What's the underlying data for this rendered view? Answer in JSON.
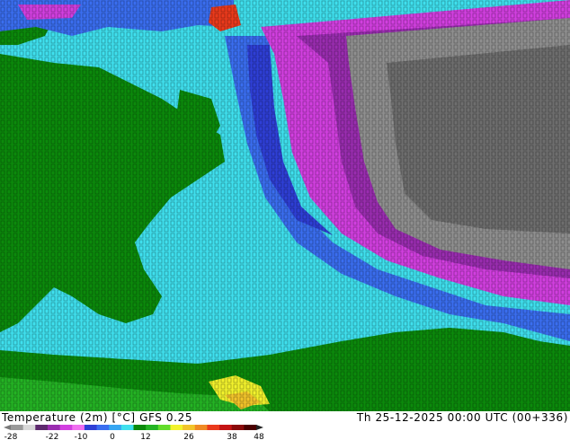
{
  "caption": {
    "variable": "Temperature (2m) [°C]",
    "model": "GFS 0.25",
    "valid_time": "Th 25-12-2025 00:00 UTC (00+336)"
  },
  "colorbar": {
    "ticks": [
      "-28",
      "-22",
      "-10",
      "0",
      "12",
      "26",
      "38",
      "48"
    ],
    "colors": [
      "#9a9a9a",
      "#d8d8d8",
      "#5e2a6e",
      "#9a2db0",
      "#d23fe0",
      "#f06ff0",
      "#2e3fd6",
      "#3a6ef0",
      "#36a6f2",
      "#3fe0ee",
      "#0b8a0b",
      "#24b424",
      "#62dc2a",
      "#f2f22c",
      "#f2c42a",
      "#f08a24",
      "#ea3a1c",
      "#c41414",
      "#8a0a0a",
      "#4a0000"
    ]
  },
  "regions": {
    "ocean_cold": "#3fe0ee",
    "land_mild": "#0b8a0b",
    "arctic_land": "#9a2db0",
    "ice_core": "#8f8f8f",
    "fjord_blue": "#2e3fd6"
  }
}
